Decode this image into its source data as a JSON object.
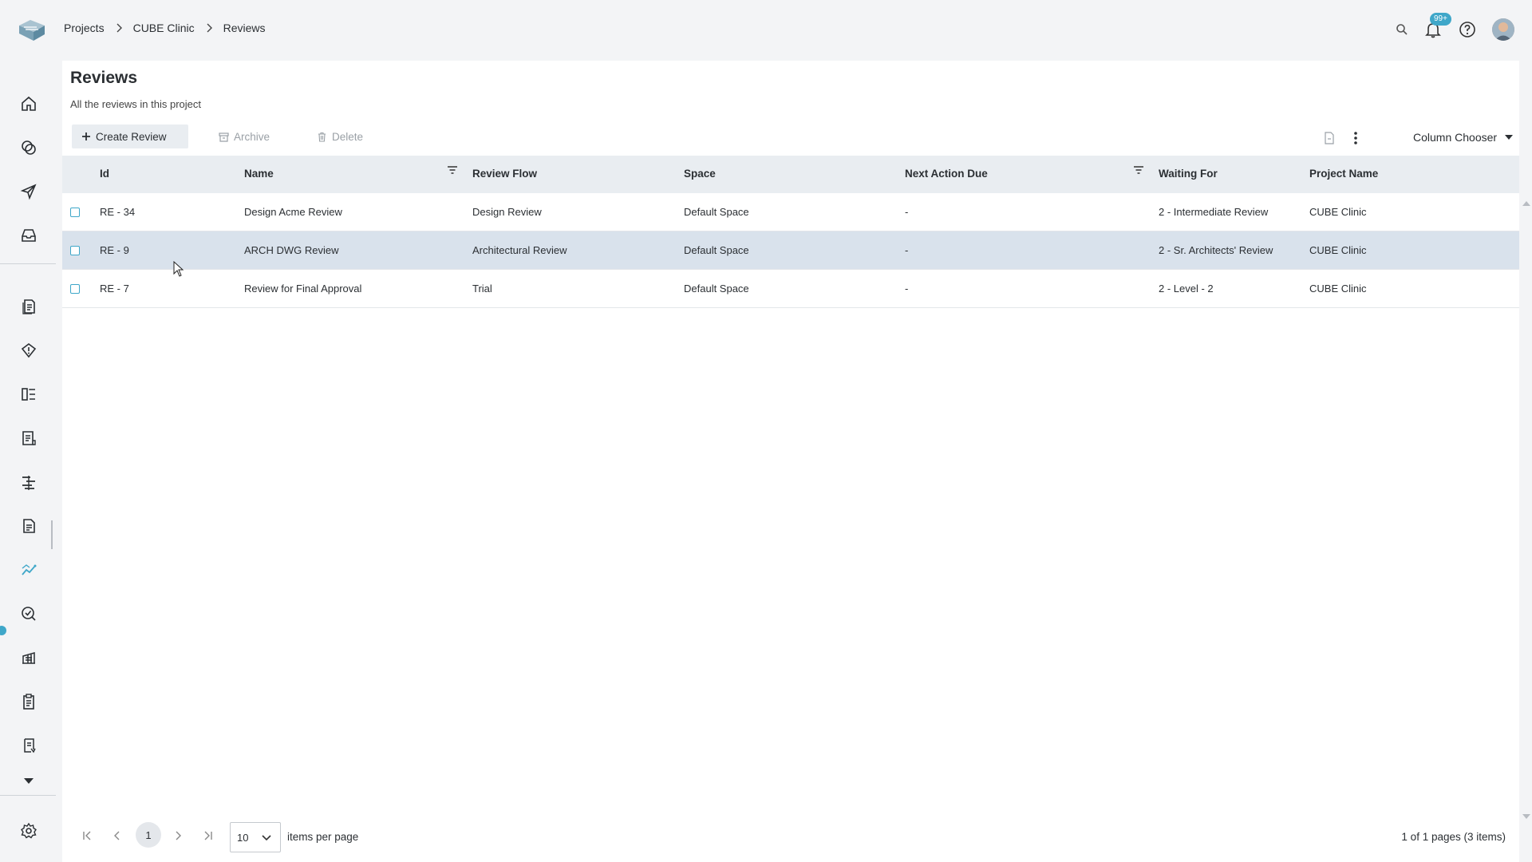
{
  "breadcrumb": [
    "Projects",
    "CUBE Clinic",
    "Reviews"
  ],
  "notifications": {
    "count": "99+"
  },
  "page": {
    "title": "Reviews",
    "subtitle": "All the reviews in this project"
  },
  "toolbar": {
    "create_label": "Create Review",
    "archive_label": "Archive",
    "delete_label": "Delete",
    "column_chooser_label": "Column Chooser"
  },
  "table": {
    "headers": [
      "Id",
      "Name",
      "Review Flow",
      "Space",
      "Next Action Due",
      "Waiting For",
      "Project Name"
    ],
    "rows": [
      {
        "id": "RE - 34",
        "name": "Design Acme Review",
        "flow": "Design Review",
        "space": "Default Space",
        "due": "-",
        "waiting": "2 - Intermediate Review",
        "project": "CUBE Clinic",
        "selected": false
      },
      {
        "id": "RE - 9",
        "name": "ARCH DWG Review",
        "flow": "Architectural Review",
        "space": "Default Space",
        "due": "-",
        "waiting": "2 - Sr. Architects' Review",
        "project": "CUBE Clinic",
        "selected": true
      },
      {
        "id": "RE - 7",
        "name": "Review for Final Approval",
        "flow": "Trial",
        "space": "Default Space",
        "due": "-",
        "waiting": "2 - Level - 2",
        "project": "CUBE Clinic",
        "selected": false
      }
    ]
  },
  "pager": {
    "current_page": "1",
    "page_size": "10",
    "items_label": "items per page",
    "info": "1 of 1 pages (3 items)"
  },
  "colors": {
    "accent": "#3fa7c9",
    "selected_row": "#d9e2ec",
    "header_bg": "#e9edf1"
  }
}
